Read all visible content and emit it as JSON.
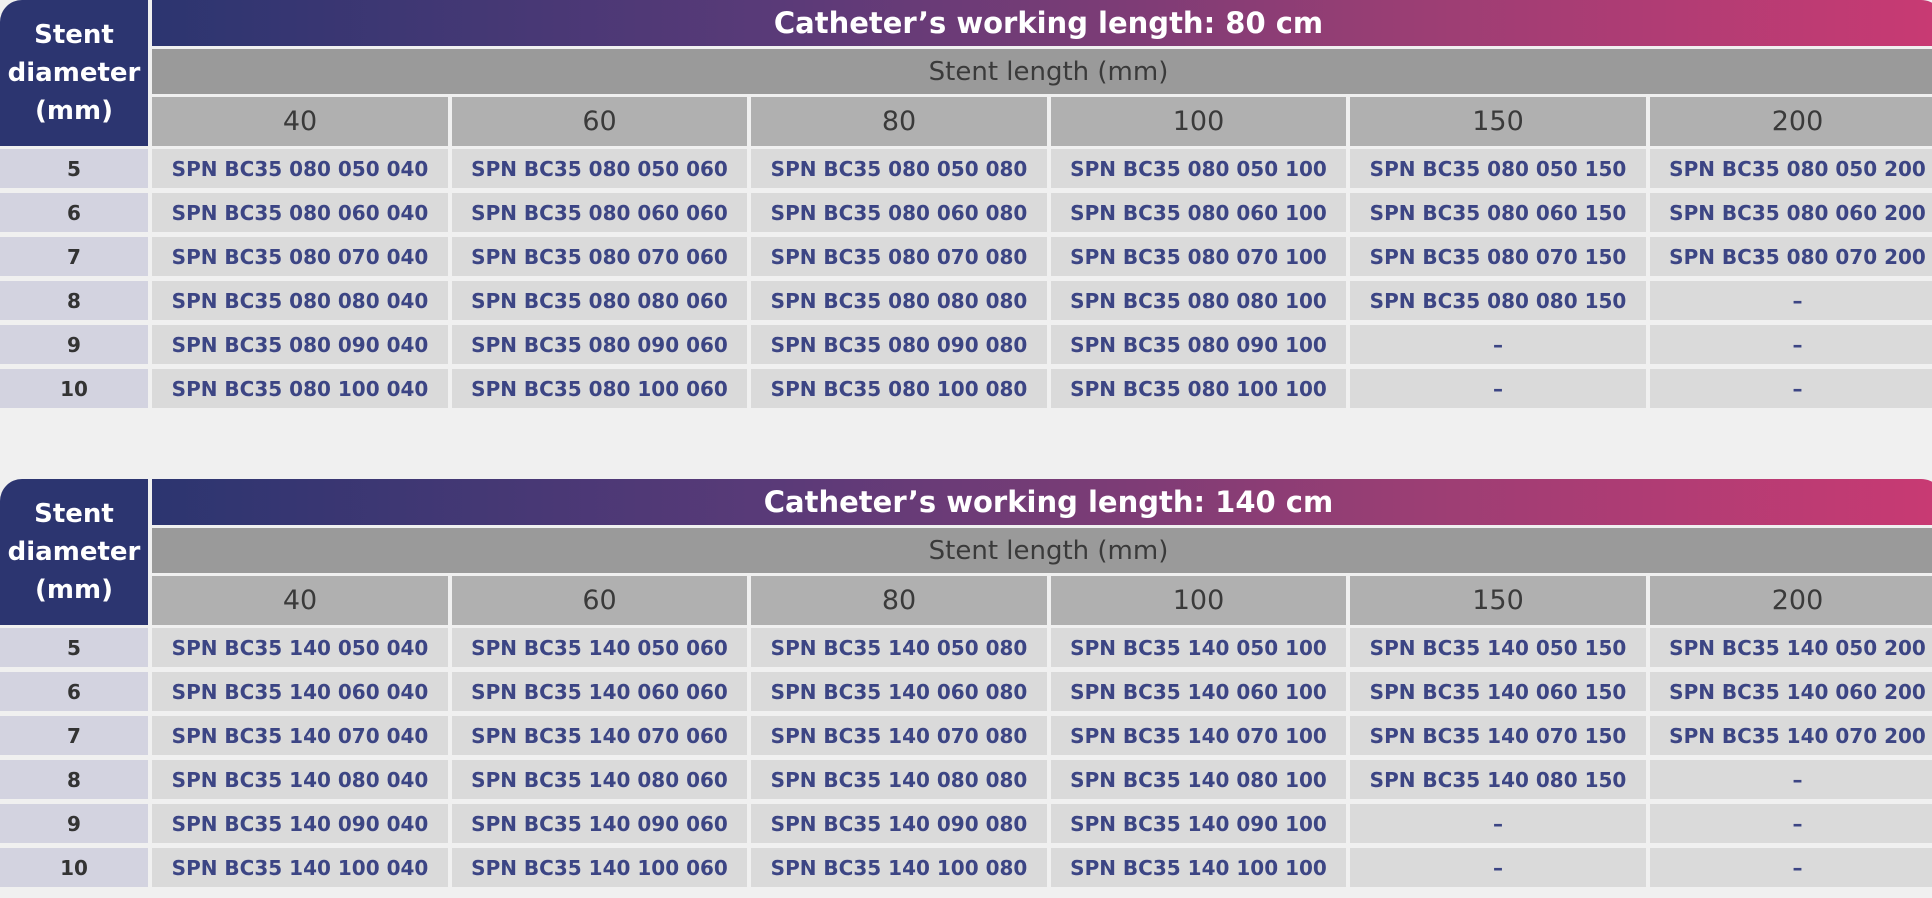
{
  "corner_label": "Stent\ndiameter\n(mm)",
  "subheader": "Stent length (mm)",
  "lengths": [
    "40",
    "60",
    "80",
    "100",
    "150",
    "200"
  ],
  "diameters": [
    "5",
    "6",
    "7",
    "8",
    "9",
    "10"
  ],
  "tables": [
    {
      "title": "Catheter’s working length: 80 cm",
      "rows": [
        [
          "SPN BC35 080 050 040",
          "SPN BC35 080 050 060",
          "SPN BC35 080 050 080",
          "SPN BC35 080 050 100",
          "SPN BC35 080 050 150",
          "SPN BC35 080 050 200"
        ],
        [
          "SPN BC35 080 060 040",
          "SPN BC35 080 060 060",
          "SPN BC35 080 060 080",
          "SPN BC35 080 060 100",
          "SPN BC35 080 060 150",
          "SPN BC35 080 060 200"
        ],
        [
          "SPN BC35 080 070 040",
          "SPN BC35 080 070 060",
          "SPN BC35 080 070 080",
          "SPN BC35 080 070 100",
          "SPN BC35 080 070 150",
          "SPN BC35 080 070 200"
        ],
        [
          "SPN BC35 080 080 040",
          "SPN BC35 080 080 060",
          "SPN BC35 080 080 080",
          "SPN BC35 080 080 100",
          "SPN BC35 080 080 150",
          "–"
        ],
        [
          "SPN BC35 080 090 040",
          "SPN BC35 080 090 060",
          "SPN BC35 080 090 080",
          "SPN BC35 080 090 100",
          "–",
          "–"
        ],
        [
          "SPN BC35 080 100 040",
          "SPN BC35 080 100 060",
          "SPN BC35 080 100 080",
          "SPN BC35 080 100 100",
          "–",
          "–"
        ]
      ]
    },
    {
      "title": "Catheter’s working length: 140 cm",
      "rows": [
        [
          "SPN BC35 140 050 040",
          "SPN BC35 140 050 060",
          "SPN BC35 140 050 080",
          "SPN BC35 140 050 100",
          "SPN BC35 140 050 150",
          "SPN BC35 140 050 200"
        ],
        [
          "SPN BC35 140 060 040",
          "SPN BC35 140 060 060",
          "SPN BC35 140 060 080",
          "SPN BC35 140 060 100",
          "SPN BC35 140 060 150",
          "SPN BC35 140 060 200"
        ],
        [
          "SPN BC35 140 070 040",
          "SPN BC35 140 070 060",
          "SPN BC35 140 070 080",
          "SPN BC35 140 070 100",
          "SPN BC35 140 070 150",
          "SPN BC35 140 070 200"
        ],
        [
          "SPN BC35 140 080 040",
          "SPN BC35 140 080 060",
          "SPN BC35 140 080 080",
          "SPN BC35 140 080 100",
          "SPN BC35 140 080 150",
          "–"
        ],
        [
          "SPN BC35 140 090 040",
          "SPN BC35 140 090 060",
          "SPN BC35 140 090 080",
          "SPN BC35 140 090 100",
          "–",
          "–"
        ],
        [
          "SPN BC35 140 100 040",
          "SPN BC35 140 100 060",
          "SPN BC35 140 100 080",
          "SPN BC35 140 100 100",
          "–",
          "–"
        ]
      ]
    }
  ]
}
